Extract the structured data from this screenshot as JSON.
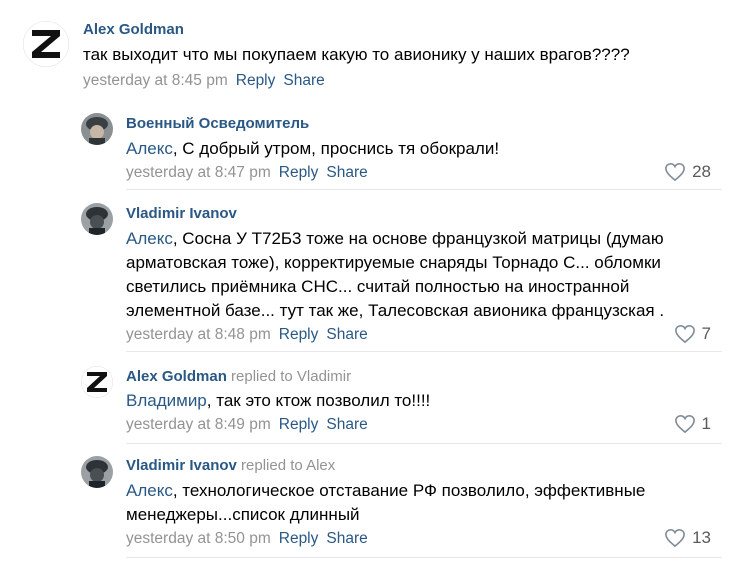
{
  "comments": [
    {
      "author": "Alex Goldman",
      "replied_to": "",
      "mention": "",
      "text": "так выходит что мы покупаем какую то авионику у наших врагов????",
      "time": "yesterday at 8:45 pm",
      "reply_label": "Reply",
      "share_label": "Share",
      "likes": "",
      "avatar": "z-logo-icon"
    },
    {
      "author": "Военный Осведомитель",
      "replied_to": "",
      "mention": "Алекс",
      "text": ", С добрый утром, проснись тя обокрали!",
      "time": "yesterday at 8:47 pm",
      "reply_label": "Reply",
      "share_label": "Share",
      "likes": "28",
      "avatar": "soldier-helmet-icon"
    },
    {
      "author": "Vladimir Ivanov",
      "replied_to": "",
      "mention": "Алекс",
      "text": ", Сосна У Т72Б3 тоже на основе французкой матрицы (думаю арматовская тоже), корректируемые снаряды Торнадо С... обломки светились приёмника СНС... считай полностью на иностранной элементной базе... тут так же, Талесовская авионика французская .",
      "time": "yesterday at 8:48 pm",
      "reply_label": "Reply",
      "share_label": "Share",
      "likes": "7",
      "avatar": "soldier-helmet-icon"
    },
    {
      "author": "Alex Goldman",
      "replied_to": "replied to Vladimir",
      "mention": "Владимир",
      "text": ", так это ктож позволил то!!!!",
      "time": "yesterday at 8:49 pm",
      "reply_label": "Reply",
      "share_label": "Share",
      "likes": "1",
      "avatar": "z-logo-icon"
    },
    {
      "author": "Vladimir Ivanov",
      "replied_to": "replied to Alex",
      "mention": "Алекс",
      "text": ", технологическое отставание РФ позволило, эффективные менеджеры...список длинный",
      "time": "yesterday at 8:50 pm",
      "reply_label": "Reply",
      "share_label": "Share",
      "likes": "13",
      "avatar": "soldier-helmet-icon"
    }
  ],
  "colors": {
    "link": "#2a5885",
    "muted": "#939393",
    "separator": "#e7e8ec"
  }
}
